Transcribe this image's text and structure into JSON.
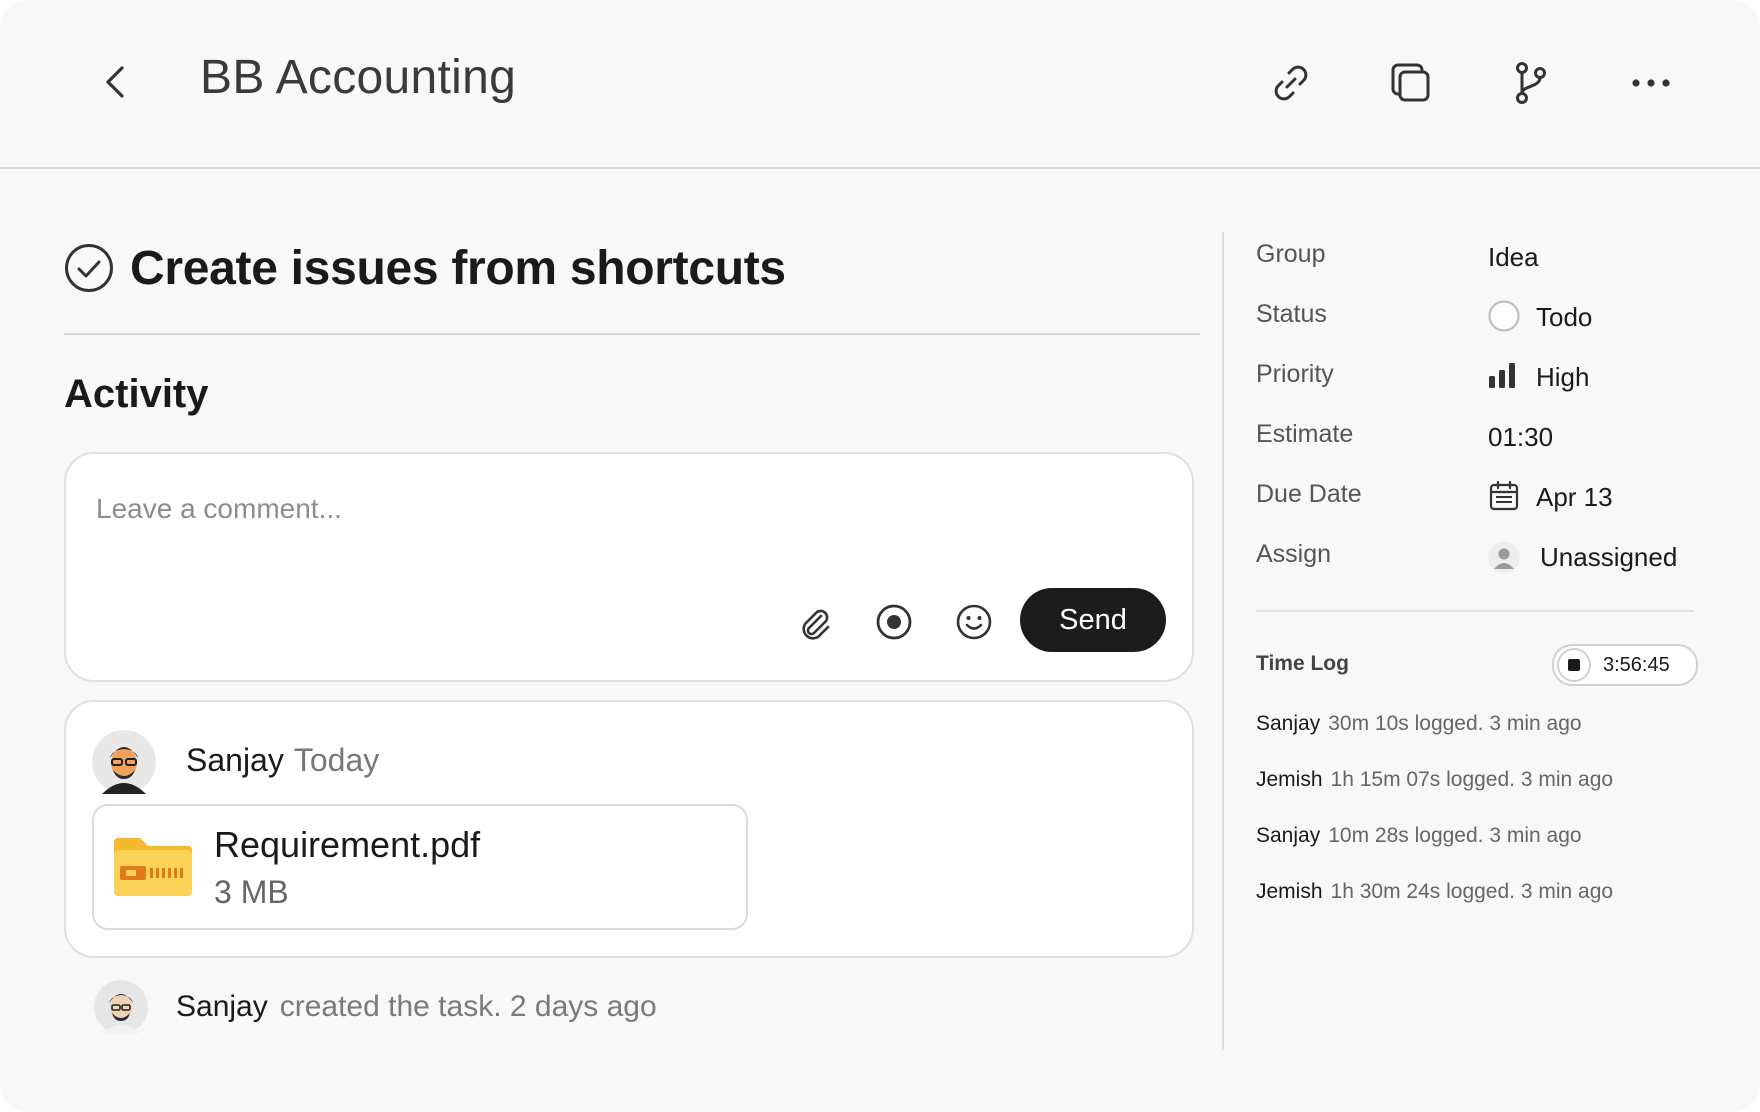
{
  "header": {
    "title": "BB Accounting",
    "icons": [
      "back-icon",
      "link-icon",
      "copy-icon",
      "branch-icon",
      "more-icon"
    ]
  },
  "task": {
    "title": "Create issues from shortcuts"
  },
  "activity": {
    "heading": "Activity",
    "comment": {
      "placeholder": "Leave a comment...",
      "value": "",
      "send_label": "Send"
    },
    "entry": {
      "author": "Sanjay",
      "time": "Today",
      "file_name": "Requirement.pdf",
      "file_size": "3 MB"
    },
    "created": {
      "author": "Sanjay",
      "text": "created the task. 2 days ago"
    }
  },
  "properties": {
    "group": {
      "label": "Group",
      "value": "Idea"
    },
    "status": {
      "label": "Status",
      "value": "Todo"
    },
    "priority": {
      "label": "Priority",
      "value": "High"
    },
    "estimate": {
      "label": "Estimate",
      "value": "01:30"
    },
    "due_date": {
      "label": "Due Date",
      "value": "Apr 13"
    },
    "assign": {
      "label": "Assign",
      "value": "Unassigned"
    }
  },
  "time_log": {
    "label": "Time Log",
    "timer": "3:56:45",
    "entries": [
      {
        "user": "Sanjay",
        "detail": "30m 10s logged.  3 min ago"
      },
      {
        "user": "Jemish",
        "detail": "1h 15m 07s logged.  3 min ago"
      },
      {
        "user": "Sanjay",
        "detail": "10m 28s logged.  3 min ago"
      },
      {
        "user": "Jemish",
        "detail": "1h 30m 24s logged.  3 min ago"
      }
    ]
  },
  "colors": {
    "background": "#f8f8f8",
    "send_button": "#1c1c1c",
    "folder": "#f7c948"
  }
}
